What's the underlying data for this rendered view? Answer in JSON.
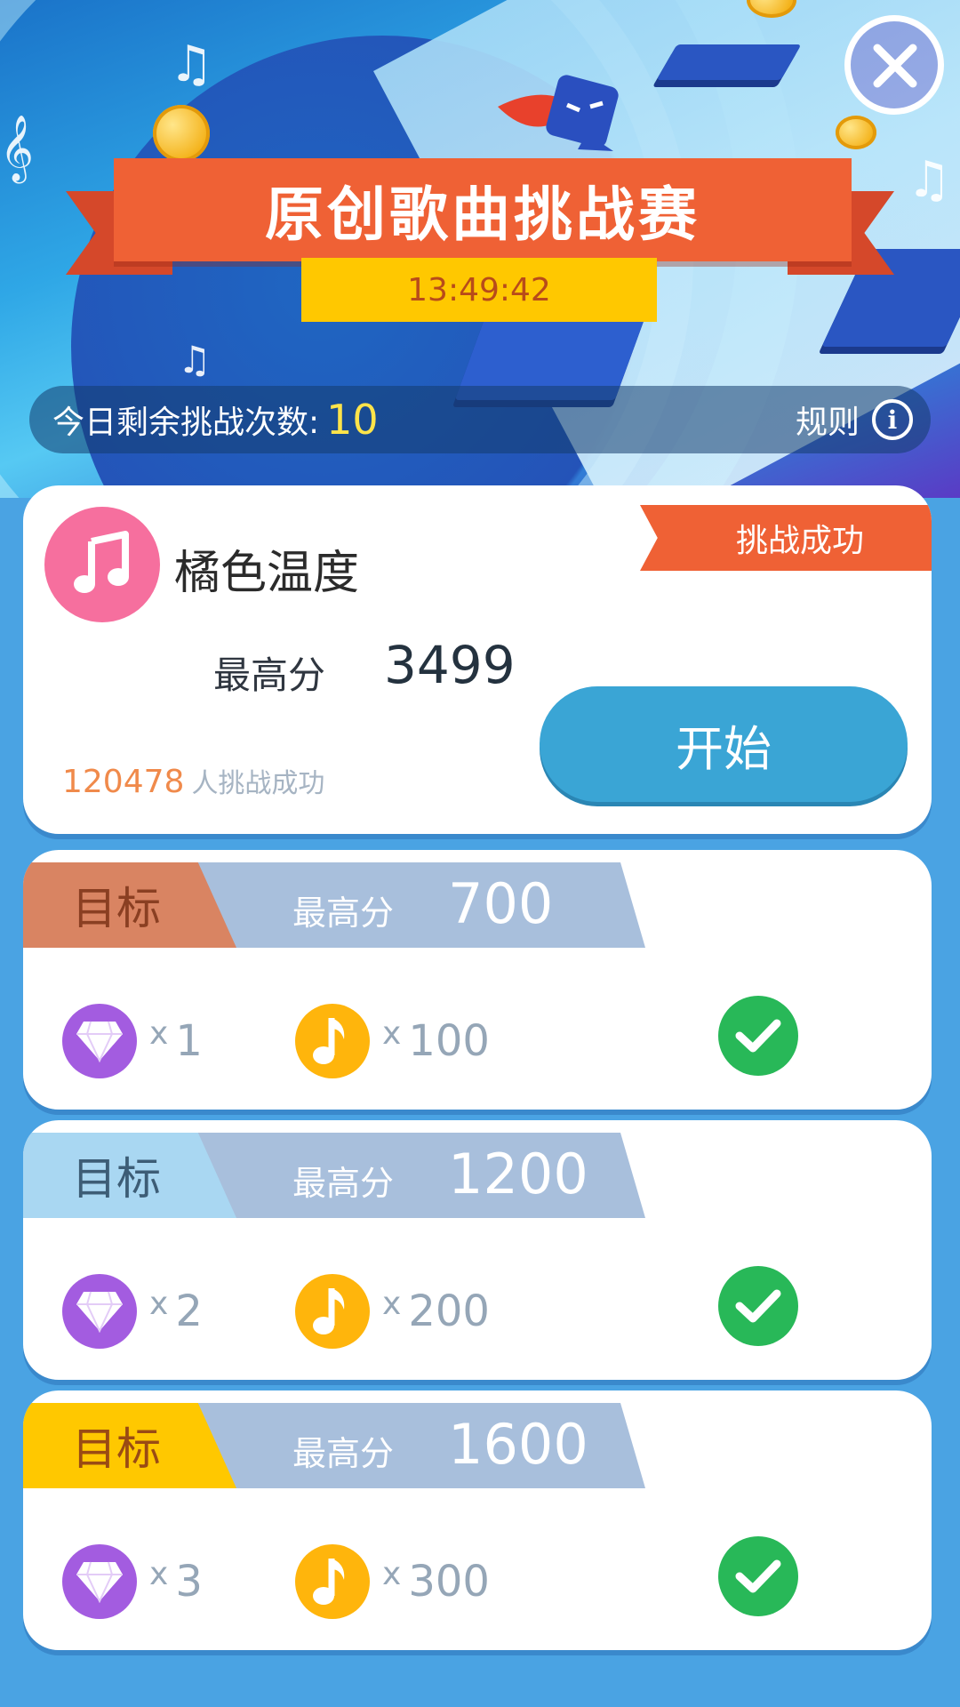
{
  "header": {
    "title": "原创歌曲挑战赛",
    "timer": "13:49:42"
  },
  "attempts": {
    "label": "今日剩余挑战次数:",
    "count": "10",
    "rules_label": "规则",
    "info_icon": "i"
  },
  "song": {
    "title": "橘色温度",
    "status": "挑战成功",
    "best_label": "最高分",
    "best_value": "3499",
    "start_label": "开始",
    "players_count": "120478",
    "players_text": "人挑战成功"
  },
  "targets": [
    {
      "tag": "目标",
      "label": "最高分",
      "score": "700",
      "x": "x",
      "gems": "1",
      "notes": "100",
      "completed": true,
      "tag_color": "#d98462"
    },
    {
      "tag": "目标",
      "label": "最高分",
      "score": "1200",
      "x": "x",
      "gems": "2",
      "notes": "200",
      "completed": true,
      "tag_color": "#a9d7f2"
    },
    {
      "tag": "目标",
      "label": "最高分",
      "score": "1600",
      "x": "x",
      "gems": "3",
      "notes": "300",
      "completed": true,
      "tag_color": "#ffc800"
    }
  ],
  "colors": {
    "accent_orange": "#ef6135",
    "timer_yellow": "#ffc800",
    "start_blue": "#3aa5d5",
    "check_green": "#28b858",
    "gem_purple": "#a35ce0",
    "note_gold": "#ffb50c"
  },
  "icons": {
    "close": "close-icon",
    "song": "music-note-icon",
    "info": "info-icon",
    "gem": "diamond-icon",
    "note": "music-note-icon",
    "check": "check-icon"
  }
}
